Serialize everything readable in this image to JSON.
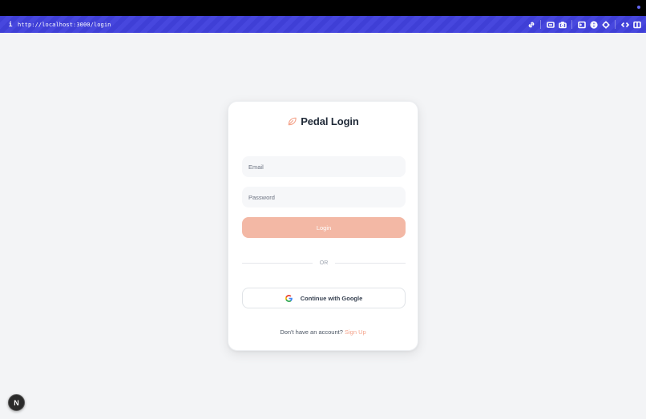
{
  "browser": {
    "url": "http://localhost:3000/login",
    "info_glyph": "i",
    "tools": [
      "link-icon",
      "screen-icon",
      "camera-icon",
      "terminal-icon",
      "globe-icon",
      "crosshair-icon",
      "code-icon",
      "panel-icon"
    ]
  },
  "login_card": {
    "title": "Pedal Login",
    "email_placeholder": "Email",
    "password_placeholder": "Password",
    "login_label": "Login",
    "divider_label": "OR",
    "google_label": "Continue with Google",
    "signup_prompt": "Don't have an account?",
    "signup_link": "Sign Up"
  },
  "next_badge": {
    "label": "N"
  },
  "colors": {
    "accent": "#f4a58d",
    "login_button": "#f3b8a5",
    "url_bar": "#3f3fd6",
    "background": "#f3f4f6"
  }
}
